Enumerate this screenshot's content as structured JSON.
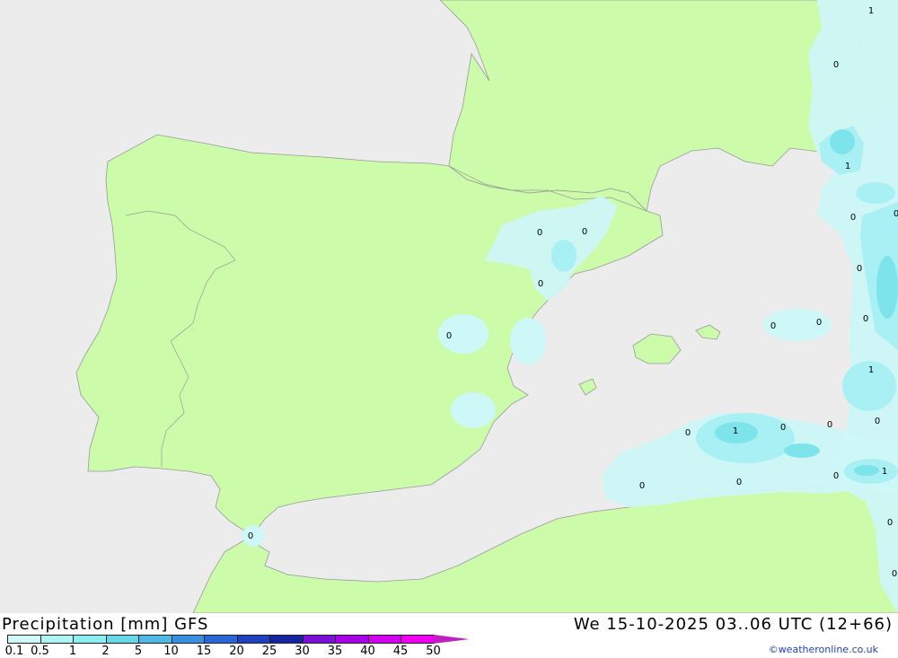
{
  "title": "Precipitation [mm] GFS",
  "datetime": "We 15-10-2025 03..06 UTC (12+66)",
  "credit": "©weatheronline.co.uk",
  "legend": {
    "ticks": [
      "0.1",
      "0.5",
      "1",
      "2",
      "5",
      "10",
      "15",
      "20",
      "25",
      "30",
      "35",
      "40",
      "45",
      "50"
    ],
    "colors": [
      "#d2f8f8",
      "#aff4f4",
      "#8ceeee",
      "#6ad7e8",
      "#4fb8e4",
      "#3a8fe0",
      "#2c66d6",
      "#1f3fbf",
      "#14239e",
      "#7a10d8",
      "#a800e6",
      "#d100ee",
      "#f000f0",
      "#c020c0"
    ]
  },
  "map": {
    "sea_color": "#ececec",
    "land_color": "#ccfcaa",
    "precip_light": "#cef7f8",
    "precip_medium": "#a8f0f4",
    "precip_heavy": "#7ee4ec",
    "values": [
      "1",
      "0",
      "1",
      "0",
      "0",
      "0",
      "0",
      "0",
      "0",
      "0",
      "0",
      "0",
      "1",
      "0",
      "1",
      "0",
      "0",
      "0",
      "0",
      "0",
      "1",
      "0",
      "0",
      "0",
      "0",
      "0"
    ]
  }
}
